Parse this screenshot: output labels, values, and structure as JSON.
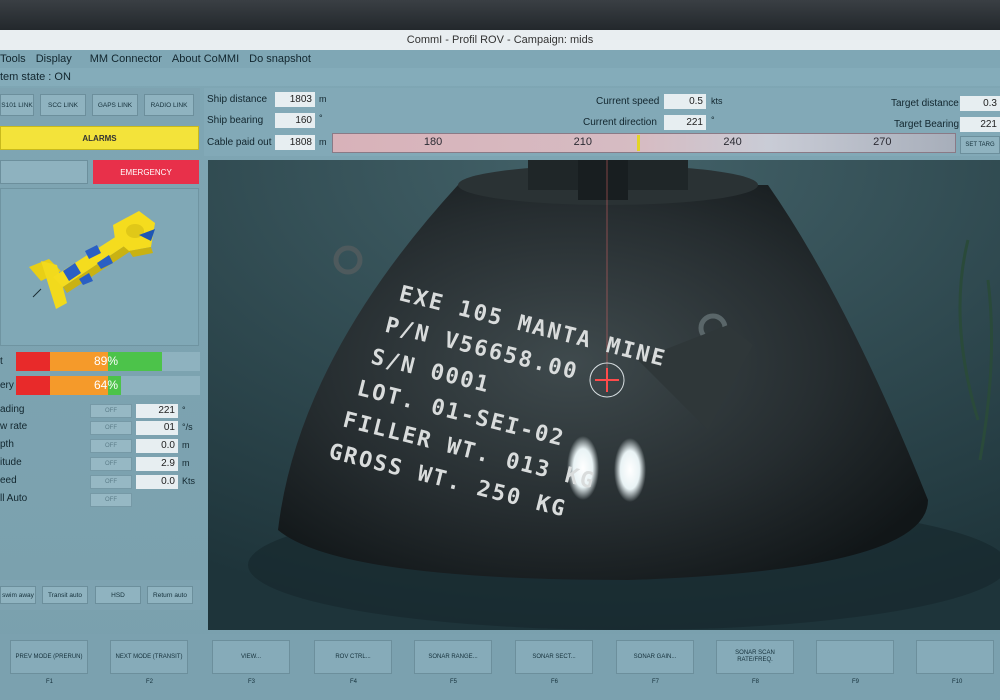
{
  "window": {
    "title": "CommI - Profil ROV - Campaign: mids"
  },
  "menu": [
    {
      "id": "tools",
      "label": "Tools"
    },
    {
      "id": "display",
      "label": "Display"
    },
    {
      "id": "mm-connector",
      "label": "MM Connector"
    },
    {
      "id": "about",
      "label": "About CoMMI"
    },
    {
      "id": "snapshot",
      "label": "Do snapshot"
    }
  ],
  "system_state": "tem state : ON",
  "links": [
    {
      "id": "s101",
      "label": "S101 LINK"
    },
    {
      "id": "scc",
      "label": "SCC LINK"
    },
    {
      "id": "gaps",
      "label": "GAPS LINK"
    },
    {
      "id": "radio",
      "label": "RADIO LINK"
    }
  ],
  "alarms_label": "ALARMS",
  "emergency_label": "EMERGENCY",
  "nav": {
    "ship_distance": {
      "label": "Ship distance",
      "value": "1803",
      "unit": "m"
    },
    "ship_bearing": {
      "label": "Ship bearing",
      "value": "160",
      "unit": "°"
    },
    "cable_paid_out": {
      "label": "Cable paid out",
      "value": "1808",
      "unit": "m"
    },
    "current_speed": {
      "label": "Current speed",
      "value": "0.5",
      "unit": "kts"
    },
    "current_direction": {
      "label": "Current direction",
      "value": "221",
      "unit": "°"
    },
    "target_distance": {
      "label": "Target distance",
      "value": "0.3"
    },
    "target_bearing": {
      "label": "Target Bearing",
      "value": "221"
    },
    "set_target_label": "SET TARG"
  },
  "compass": {
    "ticks": [
      "180",
      "210",
      "240",
      "270"
    ],
    "heading": 221
  },
  "gauges": [
    {
      "id": "thrust",
      "label": "t",
      "value": 89,
      "text": "89%"
    },
    {
      "id": "battery",
      "label": "ery",
      "value": 64,
      "text": "64%"
    }
  ],
  "telemetry": [
    {
      "id": "heading",
      "label": "ading",
      "off": "OFF",
      "value": "221",
      "unit": "°"
    },
    {
      "id": "yaw-rate",
      "label": "w rate",
      "off": "OFF",
      "value": "01",
      "unit": "°/s"
    },
    {
      "id": "depth",
      "label": "pth",
      "off": "OFF",
      "value": "0.0",
      "unit": "m"
    },
    {
      "id": "altitude",
      "label": "itude",
      "off": "OFF",
      "value": "2.9",
      "unit": "m"
    },
    {
      "id": "speed",
      "label": "eed",
      "off": "OFF",
      "value": "0.0",
      "unit": "Kts"
    },
    {
      "id": "roll-auto",
      "label": "ll Auto",
      "off": "OFF"
    }
  ],
  "mode_buttons": [
    {
      "id": "swim-away",
      "label": "swim away"
    },
    {
      "id": "transit-auto",
      "label": "Transit auto"
    },
    {
      "id": "hsd",
      "label": "HSD"
    },
    {
      "id": "return-auto",
      "label": "Return auto"
    }
  ],
  "fkeys": [
    {
      "id": "f1",
      "label": "PREV MODE (PRERUN)",
      "key": "F1"
    },
    {
      "id": "f2",
      "label": "NEXT MODE (TRANSIT)",
      "key": "F2"
    },
    {
      "id": "f3",
      "label": "VIEW...",
      "key": "F3"
    },
    {
      "id": "f4",
      "label": "ROV CTRL...",
      "key": "F4"
    },
    {
      "id": "f5",
      "label": "SONAR RANGE...",
      "key": "F5"
    },
    {
      "id": "f6",
      "label": "SONAR SECT...",
      "key": "F6"
    },
    {
      "id": "f7",
      "label": "SONAR GAIN...",
      "key": "F7"
    },
    {
      "id": "f8",
      "label": "SONAR SCAN RATE/FREQ.",
      "key": "F8"
    },
    {
      "id": "f9",
      "label": "",
      "key": "F9"
    },
    {
      "id": "f10",
      "label": "",
      "key": "F10"
    }
  ],
  "mine_stencil": [
    "EXE 105 MANTA MINE",
    "P/N V56658.00",
    "S/N 0001",
    "LOT. 01-SEI-02",
    "FILLER WT. 013 KG",
    "GROSS WT. 250 KG"
  ],
  "colors": {
    "alarm": "#f3e33a",
    "emergency": "#e8304a",
    "gauge_red": "#e82a2a",
    "gauge_orange": "#f59a2a",
    "gauge_green": "#4cc34a"
  }
}
